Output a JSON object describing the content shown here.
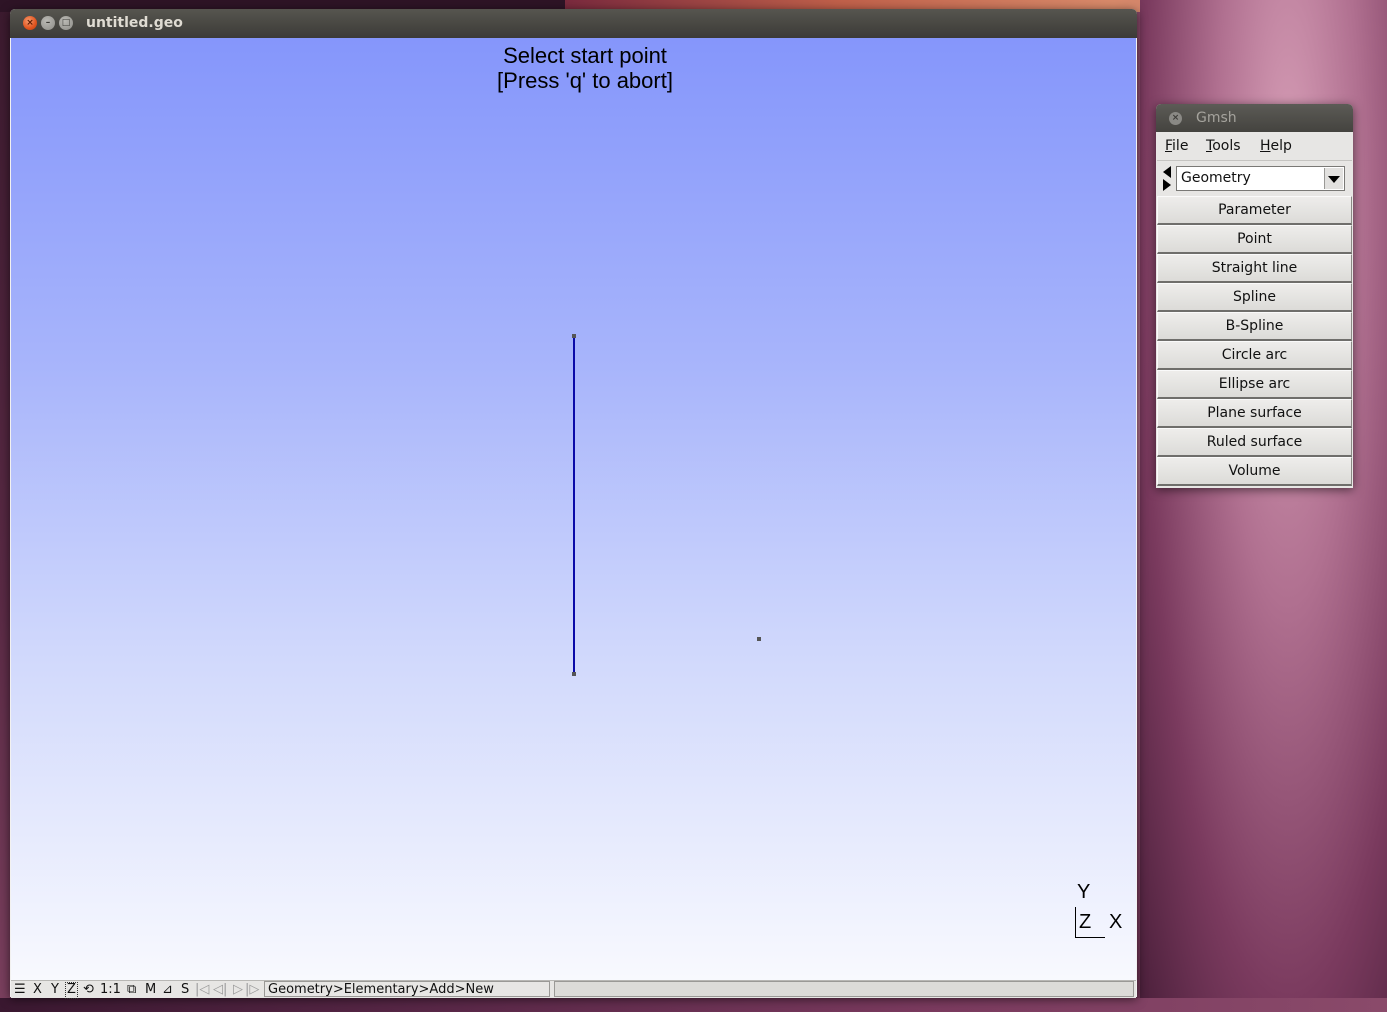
{
  "main_window": {
    "title": "untitled.geo",
    "prompt_line1": "Select start point",
    "prompt_line2": "[Press 'q' to abort]",
    "axes": {
      "y": "Y",
      "z": "Z",
      "x": "X"
    },
    "statusbar": {
      "menu_icon": "☰",
      "x": "X",
      "y": "Y",
      "z": "Z",
      "rotate_icon": "⟲",
      "scale": "1:1",
      "ortho_icon": "⧉",
      "m": "M",
      "select_icon": "⊿",
      "s": "S",
      "first_icon": "|◁",
      "prev_icon": "◁|",
      "play_icon": "▷",
      "last_icon": "|▷",
      "path": "Geometry>Elementary>Add>New"
    }
  },
  "gmsh_panel": {
    "title": "Gmsh",
    "menu": [
      {
        "underline": "F",
        "rest": "ile"
      },
      {
        "underline": "T",
        "rest": "ools"
      },
      {
        "underline": "H",
        "rest": "elp"
      }
    ],
    "module_selected": "Geometry",
    "buttons": [
      "Parameter",
      "Point",
      "Straight line",
      "Spline",
      "B-Spline",
      "Circle arc",
      "Ellipse arc",
      "Plane surface",
      "Ruled surface",
      "Volume"
    ]
  }
}
